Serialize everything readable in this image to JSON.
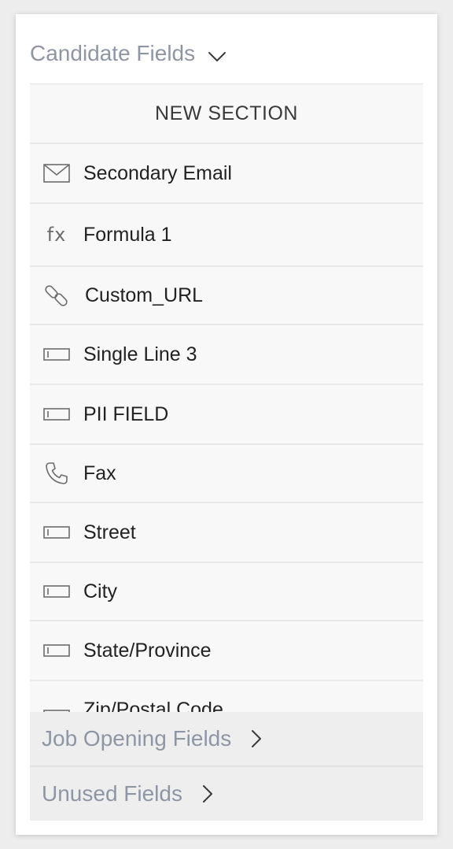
{
  "panel": {
    "active_section": {
      "label": "Candidate Fields",
      "icon": "chevron-down-icon"
    },
    "new_section_label": "NEW SECTION",
    "fields": [
      {
        "label": "Secondary Email",
        "icon": "email-icon"
      },
      {
        "label": "Formula 1",
        "icon": "formula-icon",
        "icon_text": "fx"
      },
      {
        "label": "Custom_URL",
        "icon": "link-icon"
      },
      {
        "label": "Single Line 3",
        "icon": "single-line-icon"
      },
      {
        "label": "PII FIELD",
        "icon": "single-line-icon"
      },
      {
        "label": "Fax",
        "icon": "phone-icon"
      },
      {
        "label": "Street",
        "icon": "single-line-icon"
      },
      {
        "label": "City",
        "icon": "single-line-icon"
      },
      {
        "label": "State/Province",
        "icon": "single-line-icon"
      },
      {
        "label": "Zip/Postal Code",
        "icon": "single-line-icon"
      }
    ],
    "collapsed_sections": [
      {
        "label": "Job Opening Fields",
        "icon": "chevron-right-icon"
      },
      {
        "label": "Unused Fields",
        "icon": "chevron-right-icon"
      }
    ]
  },
  "colors": {
    "section_label": "#8f96a3",
    "row_background": "#f8f8f8",
    "collapsed_background": "#eeeeee",
    "text": "#222222"
  }
}
